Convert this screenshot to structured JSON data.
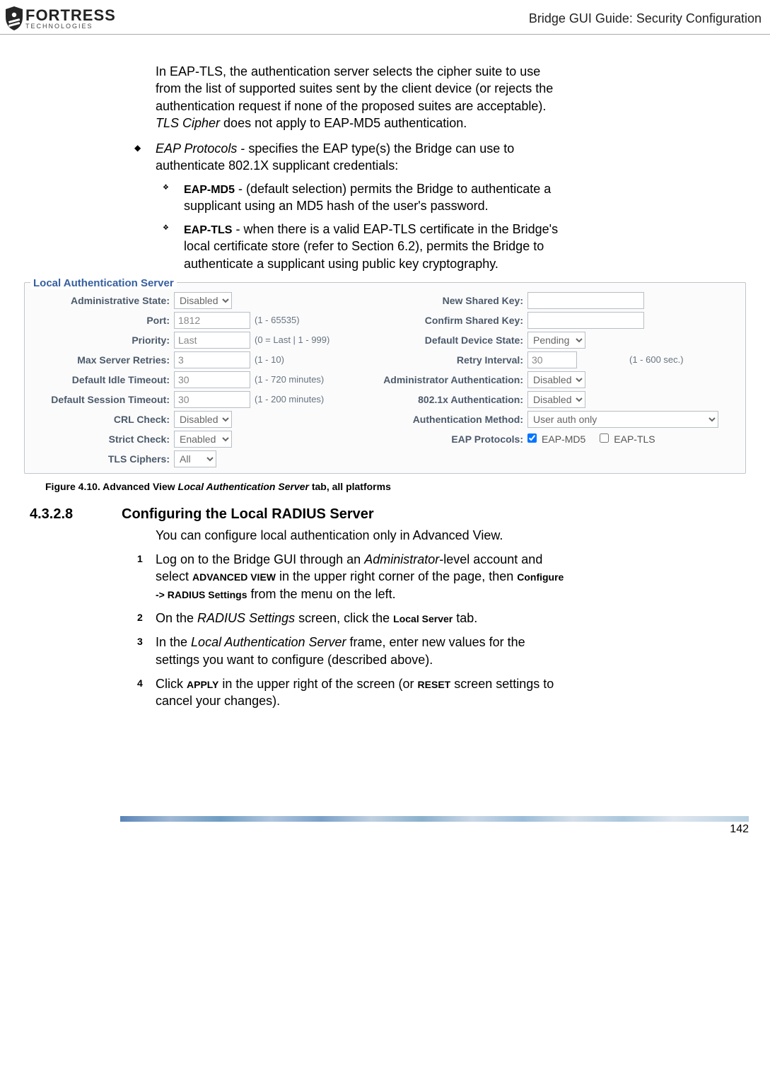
{
  "header": {
    "logo_main": "FORTRESS",
    "logo_sub": "TECHNOLOGIES",
    "title": "Bridge GUI Guide: Security Configuration"
  },
  "intro_para": {
    "p1a": "In EAP-TLS, the authentication server selects the cipher suite to use from the list of supported suites sent by the client device (or rejects the authentication request if none of the proposed suites are acceptable). ",
    "p1b": "TLS Cipher",
    "p1c": " does not apply to EAP-MD5 authentication."
  },
  "bullet": {
    "b1a": "EAP Protocols",
    "b1b": " - specifies the EAP type(s) the Bridge can use to authenticate 802.1X supplicant credentials:"
  },
  "sub_bullets": {
    "s1_label": "EAP-MD5",
    "s1_text": " - (default selection) permits the Bridge to authenticate a supplicant using an MD5 hash of the user's password.",
    "s2_label": "EAP-TLS",
    "s2_text": " - when there is a valid EAP-TLS certificate in the Bridge's local certificate store (refer to Section 6.2), permits the Bridge to authenticate a supplicant using public key cryptography."
  },
  "fieldset": {
    "title": "Local Authentication Server",
    "labels": {
      "admin_state": "Administrative State:",
      "port": "Port:",
      "priority": "Priority:",
      "max_retries": "Max Server Retries:",
      "idle_timeout": "Default Idle Timeout:",
      "session_timeout": "Default Session Timeout:",
      "crl_check": "CRL Check:",
      "strict_check": "Strict Check:",
      "tls_ciphers": "TLS Ciphers:",
      "new_key": "New Shared Key:",
      "confirm_key": "Confirm Shared Key:",
      "device_state": "Default Device State:",
      "retry_interval": "Retry Interval:",
      "admin_auth": "Administrator Authentication:",
      "dot1x_auth": "802.1x Authentication:",
      "auth_method": "Authentication Method:",
      "eap_protocols": "EAP Protocols:"
    },
    "values": {
      "admin_state": "Disabled",
      "port": "1812",
      "priority": "Last",
      "max_retries": "3",
      "idle_timeout": "30",
      "session_timeout": "30",
      "crl_check": "Disabled",
      "strict_check": "Enabled",
      "tls_ciphers": "All",
      "device_state": "Pending",
      "retry_interval": "30",
      "admin_auth": "Disabled",
      "dot1x_auth": "Disabled",
      "auth_method": "User auth only",
      "eap_md5": "EAP-MD5",
      "eap_tls": "EAP-TLS"
    },
    "hints": {
      "port": "(1 - 65535)",
      "priority": "(0 = Last | 1 - 999)",
      "max_retries": "(1 - 10)",
      "idle_timeout": "(1 - 720 minutes)",
      "session_timeout": "(1 - 200 minutes)",
      "retry_interval": "(1 - 600 sec.)"
    }
  },
  "figure_caption": {
    "pre": "Figure 4.10. Advanced View ",
    "ital": "Local Authentication Server",
    "post": " tab, all platforms"
  },
  "section": {
    "num": "4.3.2.8",
    "title": "Configuring the Local RADIUS Server",
    "intro": "You can configure local authentication only in Advanced View."
  },
  "steps": {
    "s1_a": "Log on to the Bridge GUI through an ",
    "s1_b": "Administrator",
    "s1_c": "-level account and select ",
    "s1_d": "ADVANCED VIEW",
    "s1_e": " in the upper right corner of the page, then ",
    "s1_f": "Configure -> RADIUS Settings",
    "s1_g": " from the menu on the left.",
    "s2_a": "On the ",
    "s2_b": "RADIUS Settings",
    "s2_c": " screen, click the ",
    "s2_d": "Local Server",
    "s2_e": " tab.",
    "s3_a": "In the ",
    "s3_b": "Local Authentication Server",
    "s3_c": " frame, enter new values for the settings you want to configure (described above).",
    "s4_a": "Click ",
    "s4_b": "APPLY",
    "s4_c": " in the upper right of the screen (or ",
    "s4_d": "RESET",
    "s4_e": " screen settings to cancel your changes)."
  },
  "step_numbers": {
    "n1": "1",
    "n2": "2",
    "n3": "3",
    "n4": "4"
  },
  "glyphs": {
    "diamond": "◆",
    "clover": "❖"
  },
  "page_number": "142"
}
